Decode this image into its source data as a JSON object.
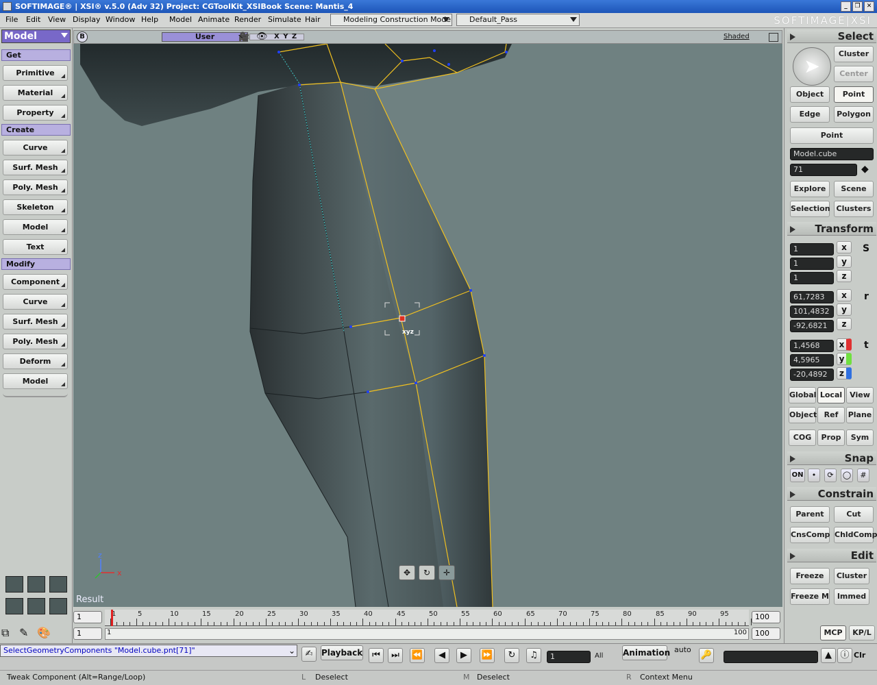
{
  "window": {
    "title": "SOFTIMAGE® | XSI® v.5.0 (Adv 32) Project: CGToolKit_XSIBook    Scene: Mantis_4",
    "brand": "SOFTIMAGE|XSI"
  },
  "menu": {
    "items": [
      "File",
      "Edit",
      "View",
      "Display",
      "Window",
      "Help",
      "Model",
      "Animate",
      "Render",
      "Simulate",
      "Hair"
    ],
    "mode": "Modeling Construction Mode",
    "pass": "Default_Pass"
  },
  "left": {
    "model_select": "Model",
    "get_header": "Get",
    "get_items": [
      "Primitive",
      "Material",
      "Property"
    ],
    "create_header": "Create",
    "create_items": [
      "Curve",
      "Surf. Mesh",
      "Poly. Mesh",
      "Skeleton",
      "Model",
      "Text"
    ],
    "modify_header": "Modify",
    "modify_items": [
      "Component",
      "Curve",
      "Surf. Mesh",
      "Poly. Mesh",
      "Deform",
      "Model"
    ]
  },
  "viewport": {
    "camera": "User",
    "axes_label": "X Y Z",
    "display_mode": "Shaded",
    "result_label": "Result",
    "cursor_label": "xyz",
    "toggle": "B"
  },
  "right": {
    "select_header": "Select",
    "cluster": "Cluster",
    "center": "Center",
    "object": "Object",
    "point": "Point",
    "edge": "Edge",
    "polygon": "Polygon",
    "point_filter": "Point",
    "object_name": "Model.cube",
    "component_index": "71",
    "explore": "Explore",
    "scene": "Scene",
    "selection": "Selection",
    "clusters": "Clusters",
    "transform_header": "Transform",
    "scale": [
      "1",
      "1",
      "1"
    ],
    "rotate": [
      "61,7283",
      "101,4832",
      "-92,6821"
    ],
    "translate": [
      "1,4568",
      "4,5965",
      "-20,4892"
    ],
    "axes": [
      "x",
      "y",
      "z"
    ],
    "sx": "S",
    "rx": "r",
    "tx": "t",
    "global": "Global",
    "local": "Local",
    "view": "View",
    "object_ref": "Object",
    "ref": "Ref",
    "plane": "Plane",
    "cog": "COG",
    "prop": "Prop",
    "sym": "Sym",
    "snap_header": "Snap",
    "snap_on": "ON",
    "constrain_header": "Constrain",
    "parent": "Parent",
    "cut": "Cut",
    "cnscomp": "CnsComp",
    "chldcomp": "ChldComp",
    "edit_header": "Edit",
    "freeze": "Freeze",
    "cluster2": "Cluster",
    "freeze_m": "Freeze M",
    "immed": "Immed",
    "mcp": "MCP",
    "kpl": "KP/L"
  },
  "timeline": {
    "start": "1",
    "end": "100",
    "range_end": "100",
    "current": "1",
    "range_start": "1",
    "range_label": "100",
    "ticks": [
      "1",
      "5",
      "10",
      "15",
      "20",
      "25",
      "30",
      "35",
      "40",
      "45",
      "50",
      "55",
      "60",
      "65",
      "70",
      "75",
      "80",
      "85",
      "90",
      "95"
    ]
  },
  "status": {
    "command": "SelectGeometryComponents \"Model.cube.pnt[71]\"",
    "playback": "Playback",
    "frame": "1",
    "all": "All",
    "animation": "Animation",
    "auto": "auto",
    "clr": "Clr",
    "hint_left": "Tweak Component  (Alt=Range/Loop)",
    "hint_l_key": "L",
    "hint_l": "Deselect",
    "hint_m_key": "M",
    "hint_m": "Deselect",
    "hint_r_key": "R",
    "hint_r": "Context Menu"
  },
  "colors": {
    "accent": "#8878d8",
    "wire": "#f0c020",
    "viewport_bg": "#6f8181"
  }
}
